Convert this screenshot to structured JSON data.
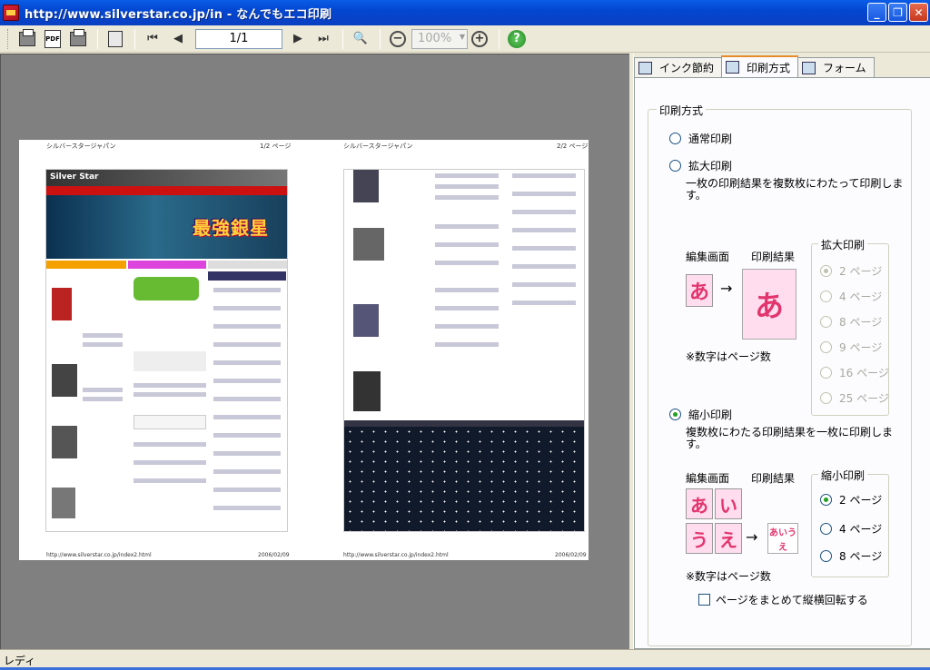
{
  "window": {
    "title": "http://www.silverstar.co.jp/in - なんでもエコ印刷"
  },
  "toolbar": {
    "pdf_label": "PDF",
    "page_value": "1/1",
    "zoom_value": "100%",
    "zoom_in": "+",
    "zoom_out": "−",
    "help": "?"
  },
  "preview": {
    "page1_header_left": "シルバースタージャパン",
    "page1_header_right": "1/2 ページ",
    "page2_header_left": "シルバースタージャパン",
    "page2_header_right": "2/2 ページ",
    "page1_footer_left": "http://www.silverstar.co.jp/index2.html",
    "page1_footer_right": "2006/02/09",
    "page2_footer_left": "http://www.silverstar.co.jp/index2.html",
    "page2_footer_right": "2006/02/09",
    "site_logo": "Silver Star",
    "banner_text": "最強銀星"
  },
  "panel": {
    "tabs": [
      "インク節約",
      "印刷方式",
      "フォーム"
    ],
    "group_title": "印刷方式",
    "normal_print": "通常印刷",
    "enlarge_print": "拡大印刷",
    "enlarge_desc": "一枚の印刷結果を複数枚にわたって印刷します。",
    "enlarge_group_title": "拡大印刷",
    "enlarge_options": [
      "2 ページ",
      "4 ページ",
      "8 ページ",
      "9 ページ",
      "16 ページ",
      "25 ページ"
    ],
    "edit_screen": "編集画面",
    "print_result": "印刷結果",
    "note": "※数字はページ数",
    "sample_chars": [
      "あ",
      "い",
      "う",
      "え"
    ],
    "reduce_print": "縮小印刷",
    "reduce_desc": "複数枚にわたる印刷結果を一枚に印刷します。",
    "reduce_group_title": "縮小印刷",
    "reduce_options": [
      "2 ページ",
      "4 ページ",
      "8 ページ"
    ],
    "rotate_checkbox": "ページをまとめて縦横回転する"
  },
  "status": {
    "text": "レディ"
  }
}
